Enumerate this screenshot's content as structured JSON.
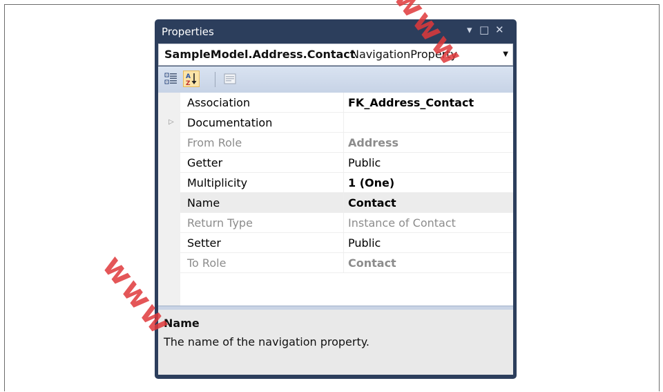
{
  "window": {
    "title": "Properties",
    "controls": {
      "dropdown_glyph": "▾",
      "maximize_glyph": "□",
      "close_glyph": "✕"
    }
  },
  "object_selector": {
    "name": "SampleModel.Address.Contact",
    "type": "NavigationProperty"
  },
  "toolbar": {
    "buttons": [
      {
        "icon": "categorized-icon",
        "state": "off"
      },
      {
        "icon": "alphabetical-icon",
        "state": "on"
      },
      {
        "icon": "property-pages-icon",
        "state": "disabled"
      }
    ]
  },
  "properties": [
    {
      "name": "Association",
      "value": "FK_Address_Contact",
      "value_style": "bold",
      "readonly": false
    },
    {
      "name": "Documentation",
      "value": "",
      "expandable": true,
      "readonly": false
    },
    {
      "name": "From Role",
      "value": "Address",
      "value_style": "bold",
      "readonly": true
    },
    {
      "name": "Getter",
      "value": "Public",
      "readonly": false
    },
    {
      "name": "Multiplicity",
      "value": "1 (One)",
      "value_style": "bold",
      "readonly": false
    },
    {
      "name": "Name",
      "value": "Contact",
      "value_style": "bold",
      "readonly": false,
      "selected": true
    },
    {
      "name": "Return Type",
      "value": "Instance of Contact",
      "readonly": true
    },
    {
      "name": "Setter",
      "value": "Public",
      "readonly": false
    },
    {
      "name": "To Role",
      "value": "Contact",
      "value_style": "bold",
      "readonly": true
    }
  ],
  "description": {
    "title": "Name",
    "text": "The name of the navigation property."
  },
  "watermark": {
    "text_top": "www",
    "text_bottom": "www",
    "color": "#e0393b"
  },
  "colors": {
    "window_frame": "#2c3e5c",
    "toolbar": "#d1dcec",
    "selected_row": "#ececec"
  }
}
